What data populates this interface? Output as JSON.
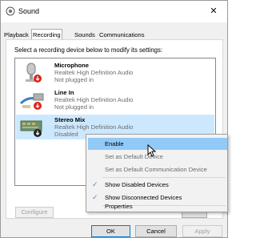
{
  "window": {
    "title": "Sound",
    "close": "✕"
  },
  "tabs": [
    "Playback",
    "Recording",
    "Sounds",
    "Communications"
  ],
  "instructions": "Select a recording device below to modify its settings:",
  "devices": [
    {
      "name": "Microphone",
      "driver": "Realtek High Definition Audio",
      "status": "Not plugged in",
      "icon": "microphone-icon"
    },
    {
      "name": "Line In",
      "driver": "Realtek High Definition Audio",
      "status": "Not plugged in",
      "icon": "line-in-icon"
    },
    {
      "name": "Stereo Mix",
      "driver": "Realtek High Definition Audio",
      "status": "Disabled",
      "icon": "stereo-mix-icon"
    }
  ],
  "configure": "Configure",
  "buttons": {
    "ok": "OK",
    "cancel": "Cancel",
    "apply": "Apply"
  },
  "menu": {
    "enable": "Enable",
    "set_default": "Set as Default Device",
    "set_default_comm": "Set as Default Communication Device",
    "show_disabled": "Show Disabled Devices",
    "show_disconnected": "Show Disconnected Devices",
    "properties": "Properties",
    "check": "✓"
  },
  "colors": {
    "selection": "#cce8ff",
    "menu_hover": "#91c9f7",
    "accent": "#0078d7",
    "status_red": "#d9251d"
  }
}
